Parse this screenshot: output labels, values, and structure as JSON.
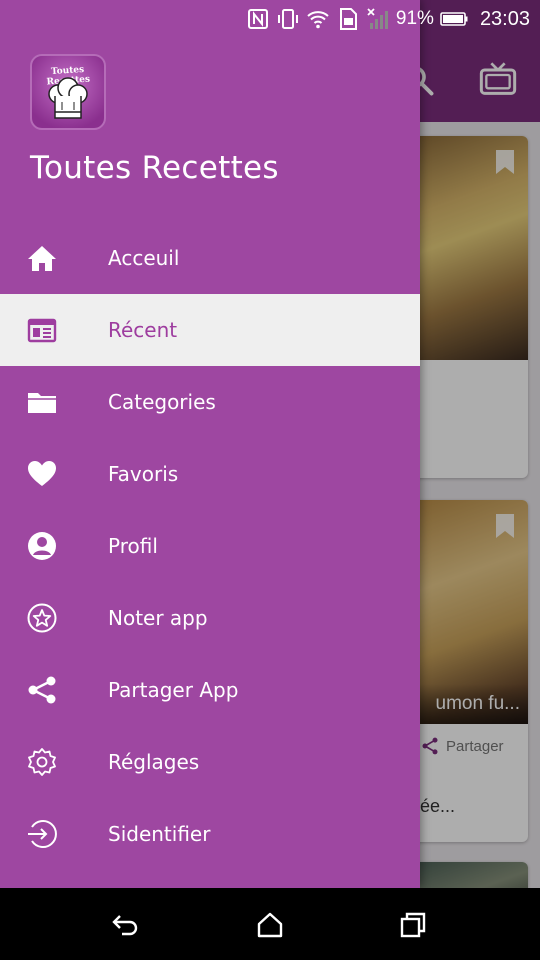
{
  "status_bar": {
    "icons": [
      "nfc-icon",
      "vibrate-icon",
      "wifi-icon",
      "sim-icon",
      "no-signal-icon"
    ],
    "battery_percent": "91%",
    "time": "23:03"
  },
  "drawer": {
    "logo_text": "Toutes Recettes",
    "title": "Toutes Recettes",
    "menu": [
      {
        "label": "Acceuil",
        "icon": "home-icon",
        "active": false
      },
      {
        "label": "Récent",
        "icon": "recent-icon",
        "active": true
      },
      {
        "label": "Categories",
        "icon": "folder-icon",
        "active": false
      },
      {
        "label": "Favoris",
        "icon": "heart-icon",
        "active": false
      },
      {
        "label": "Profil",
        "icon": "profile-icon",
        "active": false
      },
      {
        "label": "Noter app",
        "icon": "star-icon",
        "active": false
      },
      {
        "label": "Partager App",
        "icon": "share-icon",
        "active": false
      },
      {
        "label": "Réglages",
        "icon": "settings-icon",
        "active": false
      },
      {
        "label": "Sidentifier",
        "icon": "login-icon",
        "active": false
      }
    ]
  },
  "background": {
    "cards": [
      {
        "title": "",
        "share_label": "",
        "desc": ""
      },
      {
        "title": "umon fu...",
        "share_label": "Partager",
        "desc": "ée..."
      }
    ]
  },
  "colors": {
    "drawer": "#9e47a1",
    "active_text": "#9e3d9f",
    "active_bg": "#efefef",
    "toolbar": "#7b2d7d"
  },
  "nav_bar": {
    "buttons": [
      "back-icon",
      "home-nav-icon",
      "recents-icon"
    ]
  }
}
